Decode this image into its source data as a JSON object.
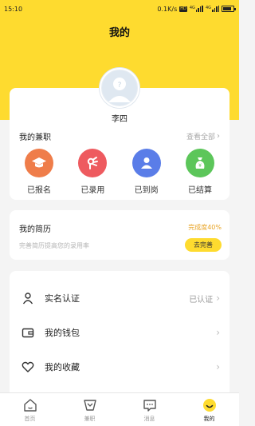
{
  "status_bar": {
    "time": "15:10",
    "net_speed": "0.1K/s",
    "hd_badge": "HD",
    "net_4g_1": "4G",
    "net_4g_2": "4G",
    "battery": "battery-icon"
  },
  "header": {
    "title": "我的"
  },
  "profile": {
    "name": "李四",
    "avatar": "user-avatar-icon"
  },
  "jobs": {
    "title": "我的兼职",
    "view_all": "查看全部",
    "items": [
      {
        "label": "已报名",
        "icon": "graduation-cap-icon",
        "color": "#ef7d4a"
      },
      {
        "label": "已录用",
        "icon": "hand-ok-icon",
        "color": "#ee5a5f"
      },
      {
        "label": "已到岗",
        "icon": "person-icon",
        "color": "#5a7de8"
      },
      {
        "label": "已结算",
        "icon": "money-bag-icon",
        "color": "#5cc65a"
      }
    ]
  },
  "resume": {
    "title": "我的简历",
    "progress": "完成度40%",
    "hint": "完善简历提高您的录用率",
    "button": "去完善"
  },
  "menu": [
    {
      "label": "实名认证",
      "value": "已认证",
      "icon": "person-outline-icon"
    },
    {
      "label": "我的钱包",
      "value": "",
      "icon": "wallet-icon"
    },
    {
      "label": "我的收藏",
      "value": "",
      "icon": "heart-icon"
    }
  ],
  "tabs": [
    {
      "label": "首页",
      "icon": "home-icon",
      "active": false
    },
    {
      "label": "兼职",
      "icon": "job-icon",
      "active": false
    },
    {
      "label": "消息",
      "icon": "message-icon",
      "active": false
    },
    {
      "label": "我的",
      "icon": "smiley-icon",
      "active": true
    }
  ],
  "colors": {
    "accent": "#fedb2f",
    "progress_text": "#e8a323"
  }
}
